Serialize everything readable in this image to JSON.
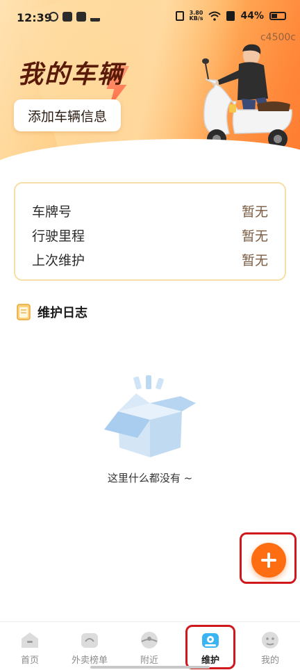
{
  "status_bar": {
    "time": "12:39",
    "net_speed_value": "3.80",
    "net_speed_unit": "KB/s",
    "battery": "44%",
    "watermark": "c4500c"
  },
  "banner": {
    "title": "我的车辆",
    "add_button_label": "添加车辆信息"
  },
  "vehicle_info": {
    "rows": [
      {
        "label": "车牌号",
        "value": "暂无"
      },
      {
        "label": "行驶里程",
        "value": "暂无"
      },
      {
        "label": "上次维护",
        "value": "暂无"
      }
    ]
  },
  "maintenance_log": {
    "title": "维护日志",
    "empty_text": "这里什么都没有 ~"
  },
  "colors": {
    "accent": "#ff6d12",
    "highlight_border": "#d0181c",
    "card_border": "#f6dfa6",
    "active_tab": "#3ab4f2"
  },
  "tabbar": {
    "tabs": [
      {
        "label": "首页",
        "icon": "home-icon",
        "active": false
      },
      {
        "label": "外卖榜单",
        "icon": "ranking-icon",
        "active": false
      },
      {
        "label": "附近",
        "icon": "nearby-icon",
        "active": false
      },
      {
        "label": "维护",
        "icon": "maintenance-icon",
        "active": true
      },
      {
        "label": "我的",
        "icon": "profile-icon",
        "active": false
      }
    ]
  }
}
